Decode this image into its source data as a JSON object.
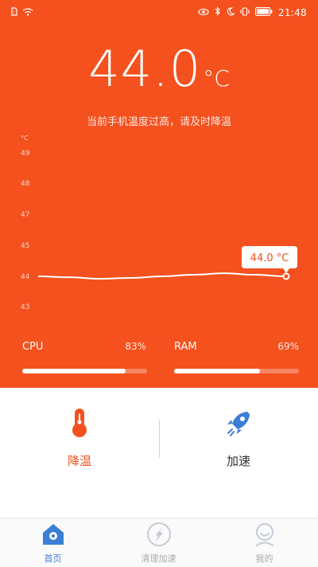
{
  "status_bar": {
    "time": "21:48"
  },
  "temperature": {
    "value": "44.0",
    "unit": "°C"
  },
  "warning_text": "当前手机温度过高，请及时降温",
  "chart_data": {
    "type": "line",
    "ylabel": "°C",
    "yticks": [
      "49",
      "48",
      "47",
      "45",
      "44",
      "43"
    ],
    "ylim": [
      43,
      49
    ],
    "series": [
      {
        "values": [
          44.0,
          43.97,
          43.92,
          43.95,
          44.0,
          44.05,
          44.1,
          44.05,
          44.0
        ]
      }
    ],
    "annotation": "44.0 °C",
    "grid": false
  },
  "stats": {
    "cpu": {
      "label": "CPU",
      "value": "83%",
      "fraction": 0.83
    },
    "ram": {
      "label": "RAM",
      "value": "69%",
      "fraction": 0.69
    }
  },
  "actions": {
    "cool": {
      "label": "降温",
      "color": "#f4511e"
    },
    "boost": {
      "label": "加速",
      "color": "#333333"
    }
  },
  "tabs": [
    {
      "label": "首页",
      "active": true
    },
    {
      "label": "清理加速",
      "active": false
    },
    {
      "label": "我的",
      "active": false
    }
  ],
  "colors": {
    "primary": "#f4511e",
    "tab_active": "#3a7fd5",
    "tab_inactive": "#aaaaaa"
  }
}
